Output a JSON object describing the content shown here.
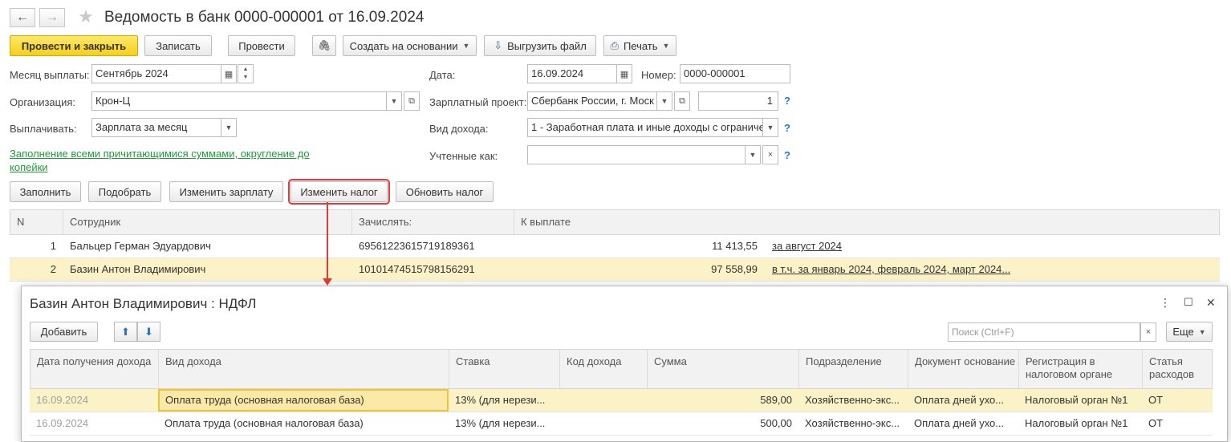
{
  "header": {
    "back_icon": "arrow-left-icon",
    "forward_icon": "arrow-right-icon",
    "star_icon": "star-icon",
    "title": "Ведомость в банк 0000-000001 от 16.09.2024"
  },
  "toolbar": {
    "post_close": "Провести и закрыть",
    "save": "Записать",
    "post": "Провести",
    "attach_icon": "paperclip-icon",
    "create_based": "Создать на основании",
    "export_file": "Выгрузить файл",
    "print": "Печать"
  },
  "form": {
    "month_label": "Месяц выплаты:",
    "month_value": "Сентябрь 2024",
    "date_label": "Дата:",
    "date_value": "16.09.2024",
    "number_label": "Номер:",
    "number_value": "0000-000001",
    "org_label": "Организация:",
    "org_value": "Крон-Ц",
    "salary_project_label": "Зарплатный проект:",
    "salary_project_value": "Сбербанк России, г. Моск",
    "salary_project_count": "1",
    "pay_label": "Выплачивать:",
    "pay_value": "Зарплата за месяц",
    "income_type_label": "Вид дохода:",
    "income_type_value": "1 - Заработная плата и иные доходы с ограниче",
    "accounted_label": "Учтенные как:",
    "accounted_value": "",
    "fill_link": "Заполнение всеми причитающимися суммами, округление до копейки",
    "help": "?"
  },
  "actions": {
    "fill": "Заполнить",
    "select": "Подобрать",
    "change_salary": "Изменить зарплату",
    "change_tax": "Изменить налог",
    "update_tax": "Обновить налог"
  },
  "table": {
    "headers": [
      "N",
      "Сотрудник",
      "Зачислять:",
      "К выплате"
    ],
    "rows": [
      {
        "n": "1",
        "employee": "Бальцер Герман Эдуардович",
        "account": "69561223615719189361",
        "amount": "11 413,55",
        "period": "за август 2024"
      },
      {
        "n": "2",
        "employee": "Базин Антон Владимирович",
        "account": "10101474515798156291",
        "amount": "97 558,99",
        "period": "в т.ч. за январь 2024, февраль 2024, март 2024..."
      }
    ]
  },
  "subwindow": {
    "title": "Базин Антон Владимирович : НДФЛ",
    "add": "Добавить",
    "search_placeholder": "Поиск (Ctrl+F)",
    "more": "Еще",
    "headers": [
      "Дата получения дохода",
      "Вид дохода",
      "Ставка",
      "Код дохода",
      "Сумма",
      "Подразделение",
      "Документ основание",
      "Регистрация в налоговом органе",
      "Статья расходов"
    ],
    "rows": [
      {
        "date": "16.09.2024",
        "income": "Оплата труда (основная налоговая база)",
        "rate": "13% (для нерези...",
        "code": "",
        "sum": "589,00",
        "dept": "Хозяйственно-экс...",
        "doc": "Оплата дней ухо...",
        "reg": "Налоговый орган №1",
        "article": "ОТ"
      },
      {
        "date": "16.09.2024",
        "income": "Оплата труда (основная налоговая база)",
        "rate": "13% (для нерези...",
        "code": "",
        "sum": "500,00",
        "dept": "Хозяйственно-экс...",
        "doc": "Оплата дней ухо...",
        "reg": "Налоговый орган №1",
        "article": "ОТ"
      }
    ]
  },
  "colors": {
    "primary": "#f5cf1b",
    "selected_row": "#fbf2c7",
    "link_green": "#1f9a3a",
    "help": "#1a7dbd",
    "highlight": "#e53935"
  }
}
